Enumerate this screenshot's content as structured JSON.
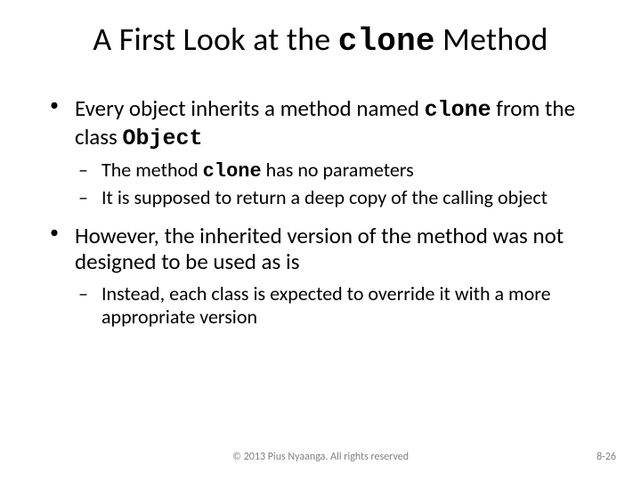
{
  "title_a": "A First Look at the ",
  "title_code": "clone",
  "title_b": " Method",
  "b1_a": "Every object inherits a method named ",
  "b1_code1": "clone",
  "b1_b": " from the class ",
  "b1_code2": "Object",
  "b1s1_a": "The method ",
  "b1s1_code": "clone",
  "b1s1_b": " has no parameters",
  "b1s2": "It is supposed to return a deep copy of the calling object",
  "b2": "However, the inherited version of the method was not designed to be used as is",
  "b2s1": "Instead, each class is expected to override it with a more appropriate version",
  "footer_center": "© 2013 Pius Nyaanga. All rights reserved",
  "footer_right": "8-26"
}
